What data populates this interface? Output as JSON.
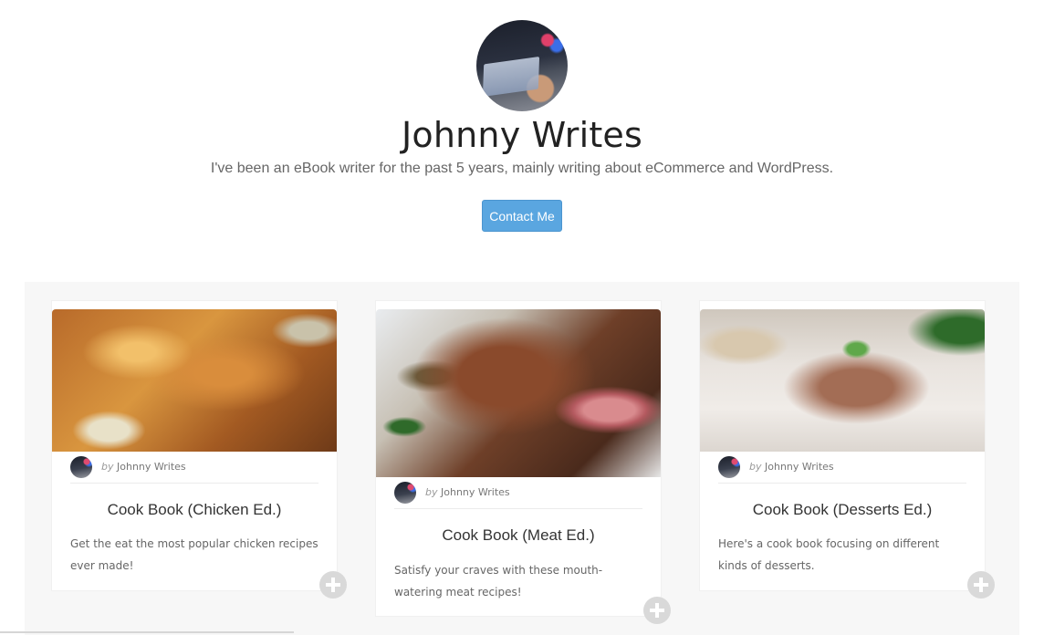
{
  "profile": {
    "name": "Johnny Writes",
    "bio": "I've been an eBook writer for the past 5 years, mainly writing about eCommerce and WordPress.",
    "contact_label": "Contact Me",
    "avatar_icon": "laptop-typing-photo"
  },
  "colors": {
    "accent": "#5aa6e0",
    "band": "#f7f7f7",
    "plus_icon": "#d9d9d9"
  },
  "cards": [
    {
      "image": "roast-chicken-photo",
      "by": "by",
      "author": "Johnny Writes",
      "title": "Cook Book (Chicken Ed.)",
      "desc": "Get the eat the most popular chicken recipes ever made!",
      "action_icon": "plus-circle-icon"
    },
    {
      "image": "roast-beef-photo",
      "by": "by",
      "author": "Johnny Writes",
      "title": "Cook Book (Meat Ed.)",
      "desc": "Satisfy your craves with these mouth-watering meat recipes!",
      "action_icon": "plus-circle-icon"
    },
    {
      "image": "tiramisu-photo",
      "by": "by",
      "author": "Johnny Writes",
      "title": "Cook Book (Desserts Ed.)",
      "desc": "Here's a cook book focusing on different kinds of desserts.",
      "action_icon": "plus-circle-icon"
    }
  ]
}
